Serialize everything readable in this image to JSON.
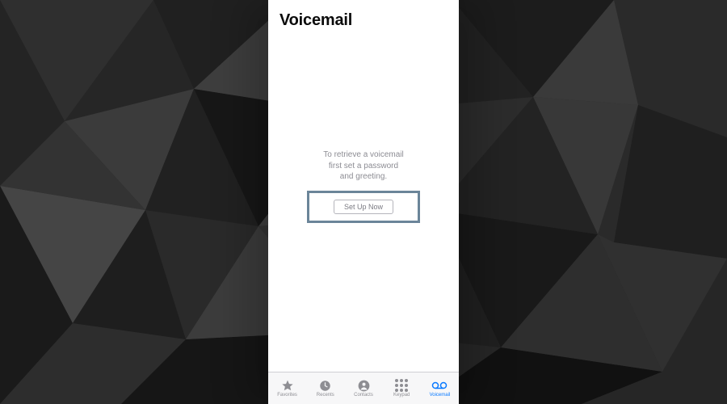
{
  "header": {
    "title": "Voicemail"
  },
  "instruction": {
    "line1": "To retrieve a voicemail",
    "line2": "first set a password",
    "line3": "and greeting."
  },
  "action": {
    "setup_label": "Set Up Now"
  },
  "tabs": {
    "favorites": "Favorites",
    "recents": "Recents",
    "contacts": "Contacts",
    "keypad": "Keypad",
    "voicemail": "Voicemail"
  },
  "colors": {
    "accent": "#0a7aff",
    "inactive": "#8e8e93",
    "highlight_border": "#6b8599"
  }
}
